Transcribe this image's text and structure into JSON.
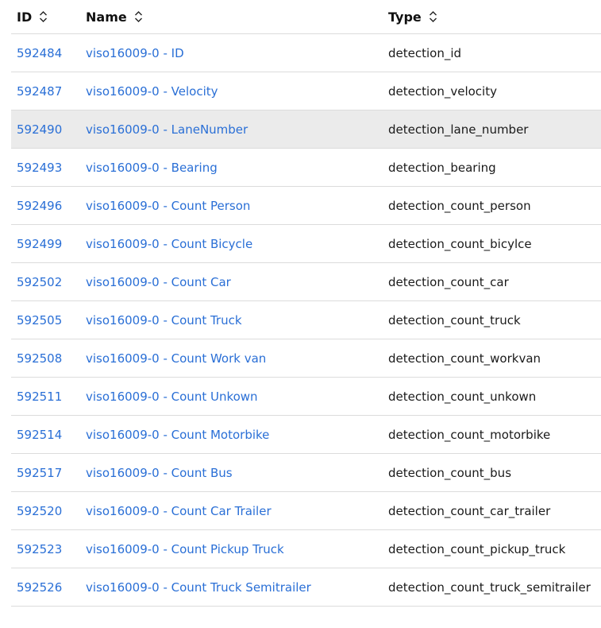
{
  "table": {
    "headers": {
      "id": "ID",
      "name": "Name",
      "type": "Type"
    },
    "highlighted_row_index": 2,
    "rows": [
      {
        "id": "592484",
        "name": "viso16009-0 - ID",
        "type": "detection_id"
      },
      {
        "id": "592487",
        "name": "viso16009-0 - Velocity",
        "type": "detection_velocity"
      },
      {
        "id": "592490",
        "name": "viso16009-0 - LaneNumber",
        "type": "detection_lane_number"
      },
      {
        "id": "592493",
        "name": "viso16009-0 - Bearing",
        "type": "detection_bearing"
      },
      {
        "id": "592496",
        "name": "viso16009-0 - Count Person",
        "type": "detection_count_person"
      },
      {
        "id": "592499",
        "name": "viso16009-0 - Count Bicycle",
        "type": "detection_count_bicylce"
      },
      {
        "id": "592502",
        "name": "viso16009-0 - Count Car",
        "type": "detection_count_car"
      },
      {
        "id": "592505",
        "name": "viso16009-0 - Count Truck",
        "type": "detection_count_truck"
      },
      {
        "id": "592508",
        "name": "viso16009-0 - Count Work van",
        "type": "detection_count_workvan"
      },
      {
        "id": "592511",
        "name": "viso16009-0 - Count Unkown",
        "type": "detection_count_unkown"
      },
      {
        "id": "592514",
        "name": "viso16009-0 - Count Motorbike",
        "type": "detection_count_motorbike"
      },
      {
        "id": "592517",
        "name": "viso16009-0 - Count Bus",
        "type": "detection_count_bus"
      },
      {
        "id": "592520",
        "name": "viso16009-0 - Count Car Trailer",
        "type": "detection_count_car_trailer"
      },
      {
        "id": "592523",
        "name": "viso16009-0 - Count Pickup Truck",
        "type": "detection_count_pickup_truck"
      },
      {
        "id": "592526",
        "name": "viso16009-0 - Count Truck Semitrailer",
        "type": "detection_count_truck_semitrailer"
      }
    ]
  },
  "icons": {
    "sort": "sort-icon"
  },
  "colors": {
    "link": "#2a6fd6",
    "highlight_row": "#ebebeb",
    "divider": "#dcdcdc"
  }
}
